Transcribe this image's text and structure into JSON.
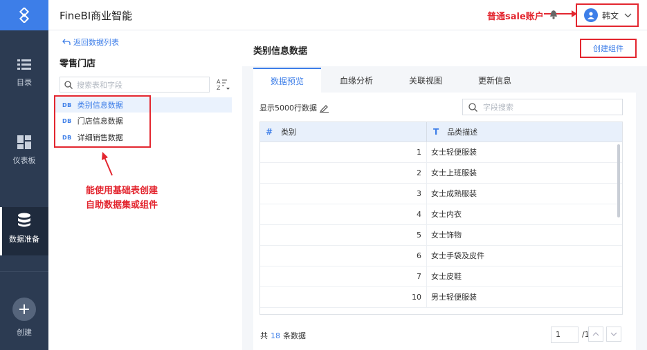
{
  "nav": {
    "items": [
      {
        "label": "目录",
        "icon": "list-icon"
      },
      {
        "label": "仪表板",
        "icon": "dashboard-icon"
      },
      {
        "label": "数据准备",
        "icon": "database-icon"
      },
      {
        "label": "创建",
        "icon": "plus-icon"
      }
    ]
  },
  "topbar": {
    "title": "FineBI商业智能",
    "annotation": "普通sale账户",
    "user_name": "韩文"
  },
  "left": {
    "back_label": "返回数据列表",
    "package_title": "零售门店",
    "search_placeholder": "搜索表和字段",
    "tag": "DB",
    "tables": [
      "类别信息数据",
      "门店信息数据",
      "详细销售数据"
    ],
    "annotation_line1": "能使用基础表创建",
    "annotation_line2": "自助数据集或组件"
  },
  "main": {
    "title": "类别信息数据",
    "create_button": "创建组件",
    "tabs": [
      "数据预览",
      "血缘分析",
      "关联视图",
      "更新信息"
    ],
    "active_tab": "数据预览",
    "row_count_text": "显示5000行数据",
    "field_search_placeholder": "字段搜索",
    "columns": [
      {
        "type_symbol": "#",
        "name": "类别"
      },
      {
        "type_symbol": "T",
        "name": "品类描述"
      }
    ],
    "rows": [
      {
        "id": "1",
        "desc": "女士轻便服装"
      },
      {
        "id": "2",
        "desc": "女士上班服装"
      },
      {
        "id": "3",
        "desc": "女士成熟服装"
      },
      {
        "id": "4",
        "desc": "女士内衣"
      },
      {
        "id": "5",
        "desc": "女士饰物"
      },
      {
        "id": "6",
        "desc": "女士手袋及皮件"
      },
      {
        "id": "7",
        "desc": "女士皮鞋"
      },
      {
        "id": "10",
        "desc": "男士轻便服装"
      }
    ],
    "footer": {
      "prefix": "共",
      "count": "18",
      "suffix": "条数据"
    },
    "pagination": {
      "current": "1",
      "total": "/1"
    }
  },
  "colors": {
    "accent": "#3d7ee8",
    "nav_bg": "#2c3b52",
    "annotation": "#e3262f"
  }
}
